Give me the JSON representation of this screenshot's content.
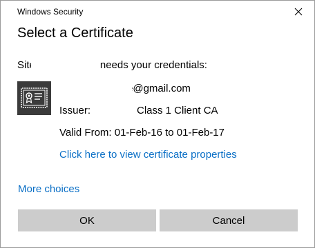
{
  "window": {
    "title": "Windows Security",
    "close_glyph": "close-icon"
  },
  "dialog": {
    "heading": "Select a Certificate",
    "site_prefix": "Site",
    "site_suffix": "needs your credentials:"
  },
  "certificate": {
    "icon": "certificate-icon",
    "email": "e@gmail.com",
    "issuer_label": "Issuer:",
    "issuer_value": "Class 1 Client CA",
    "valid_from": "Valid From: 01-Feb-16 to 01-Feb-17",
    "properties_link": "Click here to view certificate properties"
  },
  "more_choices": "More choices",
  "buttons": {
    "ok": "OK",
    "cancel": "Cancel"
  },
  "colors": {
    "link": "#0a6fc6",
    "button_bg": "#cccccc",
    "icon_bg": "#3b3b3b"
  }
}
